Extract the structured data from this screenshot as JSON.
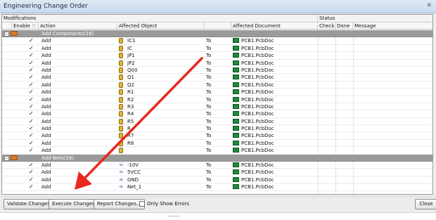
{
  "window": {
    "title": "Engineering Change Order"
  },
  "header": {
    "modifications": "Modifications",
    "status": "Status",
    "columns": {
      "enable": "Enable",
      "action": "Action",
      "affected_object": "Affected Object",
      "affected_document": "Affected Document",
      "check": "Check",
      "done": "Done",
      "message": "Message"
    }
  },
  "groups": [
    {
      "label": "Add Components(16)",
      "rows": [
        {
          "action": "Add",
          "object": "IC1",
          "to": "To",
          "document": "PCB1.PcbDoc"
        },
        {
          "action": "Add",
          "object": "IC",
          "to": "To",
          "document": "PCB1.PcbDoc"
        },
        {
          "action": "Add",
          "object": "JP1",
          "to": "To",
          "document": "PCB1.PcbDoc"
        },
        {
          "action": "Add",
          "object": "JP2",
          "to": "To",
          "document": "PCB1.PcbDoc"
        },
        {
          "action": "Add",
          "object": "Q00",
          "to": "To",
          "document": "PCB1.PcbDoc"
        },
        {
          "action": "Add",
          "object": "Q1",
          "to": "To",
          "document": "PCB1.PcbDoc"
        },
        {
          "action": "Add",
          "object": "Q2",
          "to": "To",
          "document": "PCB1.PcbDoc"
        },
        {
          "action": "Add",
          "object": "R1",
          "to": "To",
          "document": "PCB1.PcbDoc"
        },
        {
          "action": "Add",
          "object": "R2",
          "to": "To",
          "document": "PCB1.PcbDoc"
        },
        {
          "action": "Add",
          "object": "R3",
          "to": "To",
          "document": "PCB1.PcbDoc"
        },
        {
          "action": "Add",
          "object": "R4",
          "to": "To",
          "document": "PCB1.PcbDoc"
        },
        {
          "action": "Add",
          "object": "R5",
          "to": "To",
          "document": "PCB1.PcbDoc"
        },
        {
          "action": "Add",
          "object": "R",
          "to": "To",
          "document": "PCB1.PcbDoc"
        },
        {
          "action": "Add",
          "object": "R7",
          "to": "To",
          "document": "PCB1.PcbDoc"
        },
        {
          "action": "Add",
          "object": "R8",
          "to": "To",
          "document": "PCB1.PcbDoc"
        },
        {
          "action": "Add",
          "object": "",
          "to": "To",
          "document": "PCB1.PcbDoc"
        }
      ]
    },
    {
      "label": "Add Nets(16)",
      "rows": [
        {
          "action": "Add",
          "object": "-10V",
          "to": "To",
          "document": "PCB1.PcbDoc"
        },
        {
          "action": "Add",
          "object": "5VCC",
          "to": "To",
          "document": "PCB1.PcbDoc"
        },
        {
          "action": "Add",
          "object": "GND",
          "to": "To",
          "document": "PCB1.PcbDoc"
        },
        {
          "action": "Add",
          "object": "Net_1",
          "to": "To",
          "document": "PCB1.PcbDoc"
        }
      ]
    }
  ],
  "buttons": {
    "validate": "Validate Changes",
    "execute": "Execute Changes",
    "report": "Report Changes...",
    "only_show_errors": "Only Show Errors",
    "close": "Close"
  },
  "colors": {
    "arrow": "#e8281e",
    "folder": "#e07b25",
    "group_row": "#9a9a9a",
    "pcb_icon": "#1f8a3f"
  },
  "icons": {
    "group": "folder-icon",
    "component": "component-icon",
    "net": "net-icon",
    "document": "pcb-document-icon"
  }
}
